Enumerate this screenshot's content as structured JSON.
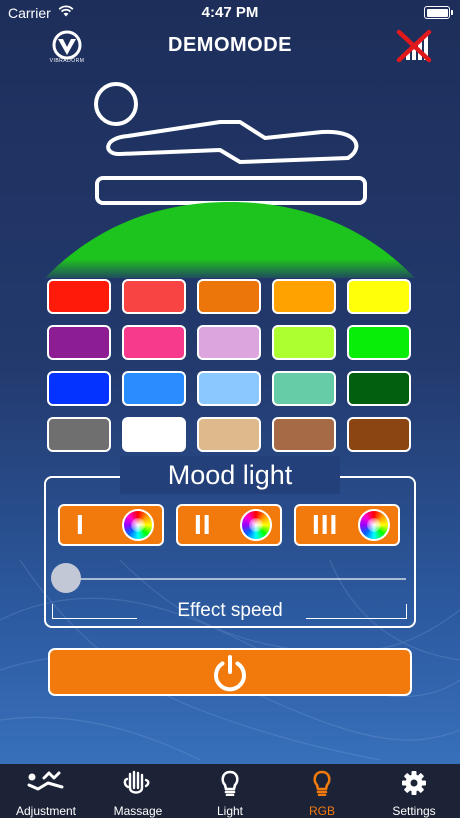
{
  "status_bar": {
    "carrier": "Carrier",
    "time": "4:47 PM"
  },
  "header": {
    "title": "DEMOMODE",
    "logo_text": "VIBRADORM",
    "connection_icon": "no-signal-icon"
  },
  "palette": {
    "colors": [
      "#ff1a0a",
      "#f94444",
      "#ec760a",
      "#ffa200",
      "#ffff0a",
      "#8d1d92",
      "#f83a8c",
      "#dca5dd",
      "#adff2f",
      "#09ee09",
      "#0433ff",
      "#2a8dff",
      "#8bc8ff",
      "#66cca8",
      "#00600f",
      "#6f6f6f",
      "#ffffff",
      "#deb98c",
      "#a76a46",
      "#8b4513"
    ],
    "active_color": "#1ec41e"
  },
  "mood": {
    "title": "Mood light",
    "buttons": [
      {
        "label": "I"
      },
      {
        "label": "II"
      },
      {
        "label": "III"
      }
    ],
    "effect_speed_label": "Effect speed",
    "effect_speed_value": 0
  },
  "power": {
    "icon": "power-icon"
  },
  "tabs": [
    {
      "label": "Adjustment",
      "icon": "adjustment-icon",
      "active": false
    },
    {
      "label": "Massage",
      "icon": "massage-icon",
      "active": false
    },
    {
      "label": "Light",
      "icon": "bulb-icon",
      "active": false
    },
    {
      "label": "RGB",
      "icon": "bulb-icon",
      "active": true
    },
    {
      "label": "Settings",
      "icon": "gear-icon",
      "active": false
    }
  ],
  "colors": {
    "accent": "#f27a0d",
    "tab_bar": "#1c2336"
  }
}
